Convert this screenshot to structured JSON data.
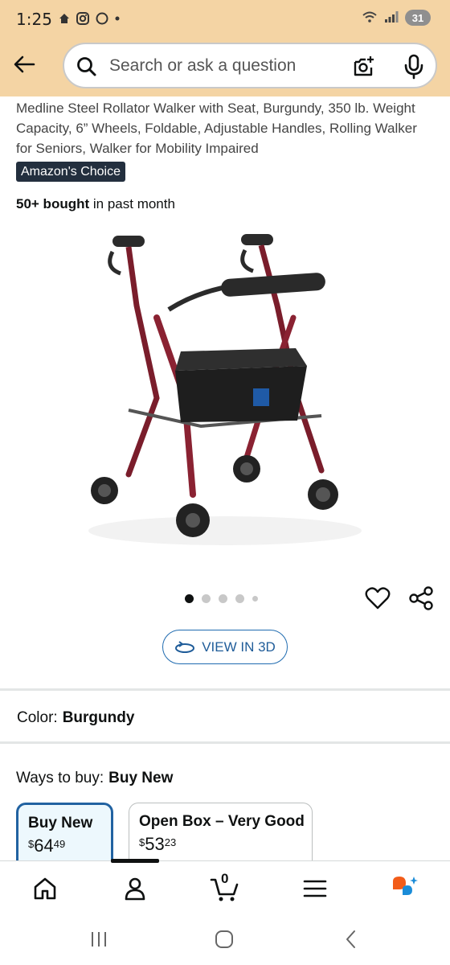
{
  "status_bar": {
    "time": "1:25",
    "battery": "31",
    "icons": [
      "home-notification-icon",
      "instagram-icon",
      "assistant-icon",
      "dot-icon"
    ],
    "right_icons": [
      "wifi-icon",
      "signal-icon",
      "battery-icon"
    ]
  },
  "header": {
    "search_placeholder": "Search or ask a question",
    "background": "#f4d4a4"
  },
  "product": {
    "title": "Medline Steel Rollator Walker with Seat, Burgundy, 350 lb. Weight Capacity, 6” Wheels, Foldable, Adjustable Handles, Rolling Walker for Seniors, Walker for Mobility Impaired",
    "badge": "Amazon's Choice",
    "bought_bold": "50+ bought",
    "bought_rest": " in past month",
    "image_dots_total": 5,
    "image_dot_active": 1,
    "view_3d_label": "VIEW IN 3D",
    "brand_color": "#7a1d2b"
  },
  "color": {
    "label": "Color:",
    "value": "Burgundy"
  },
  "ways_to_buy": {
    "label": "Ways to buy:",
    "value": "Buy New",
    "options": [
      {
        "title": "Buy New",
        "currency": "$",
        "whole": "64",
        "cents": "49",
        "selected": true
      },
      {
        "title": "Open Box – Very Good",
        "currency": "$",
        "whole": "53",
        "cents": "23",
        "selected": false
      }
    ]
  },
  "bottom_nav": {
    "items": [
      "home-icon",
      "account-icon",
      "cart-icon",
      "menu-icon",
      "rufus-icon"
    ],
    "cart_count": "0"
  }
}
